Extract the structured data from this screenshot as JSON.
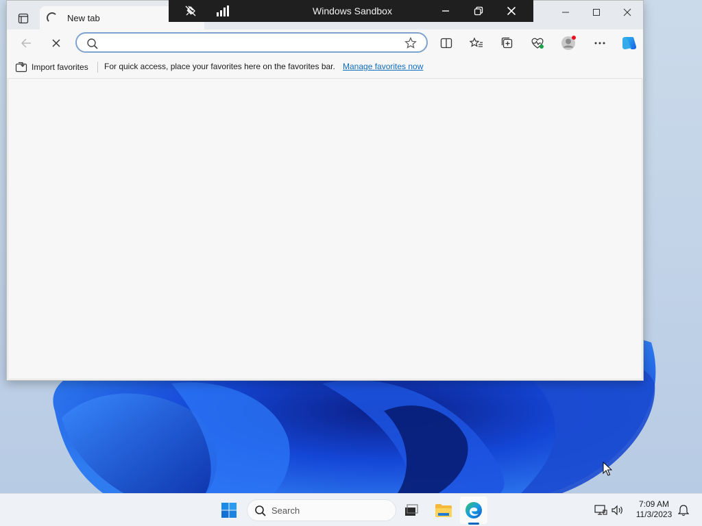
{
  "browser": {
    "tab": {
      "title": "New tab"
    },
    "address": {
      "value": "",
      "placeholder": ""
    },
    "favorites_bar": {
      "import_label": "Import favorites",
      "message": "For quick access, place your favorites here on the favorites bar.",
      "link_label": "Manage favorites now"
    }
  },
  "sandbox_bar": {
    "title": "Windows Sandbox"
  },
  "taskbar": {
    "search_label": "Search",
    "time": "7:09 AM",
    "date": "11/3/2023"
  },
  "colors": {
    "accent": "#0067c0",
    "link": "#0f6cbd",
    "sandbox_bar": "#1f1f1f",
    "address_border": "#7da2ce"
  }
}
